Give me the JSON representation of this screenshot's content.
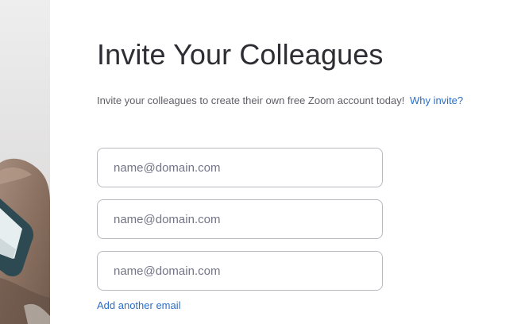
{
  "invite": {
    "title": "Invite Your Colleagues",
    "description": "Invite your colleagues to create their own free Zoom account today!",
    "why_invite_link": "Why invite?",
    "email_fields": [
      {
        "placeholder": "name@domain.com",
        "value": ""
      },
      {
        "placeholder": "name@domain.com",
        "value": ""
      },
      {
        "placeholder": "name@domain.com",
        "value": ""
      }
    ],
    "add_another_link": "Add another email"
  },
  "colors": {
    "link": "#2a6fc9",
    "title": "#2d2d33",
    "input_border": "#b9b9c0"
  },
  "decoration": {
    "left_image": "hand-holding-phone-photo"
  }
}
